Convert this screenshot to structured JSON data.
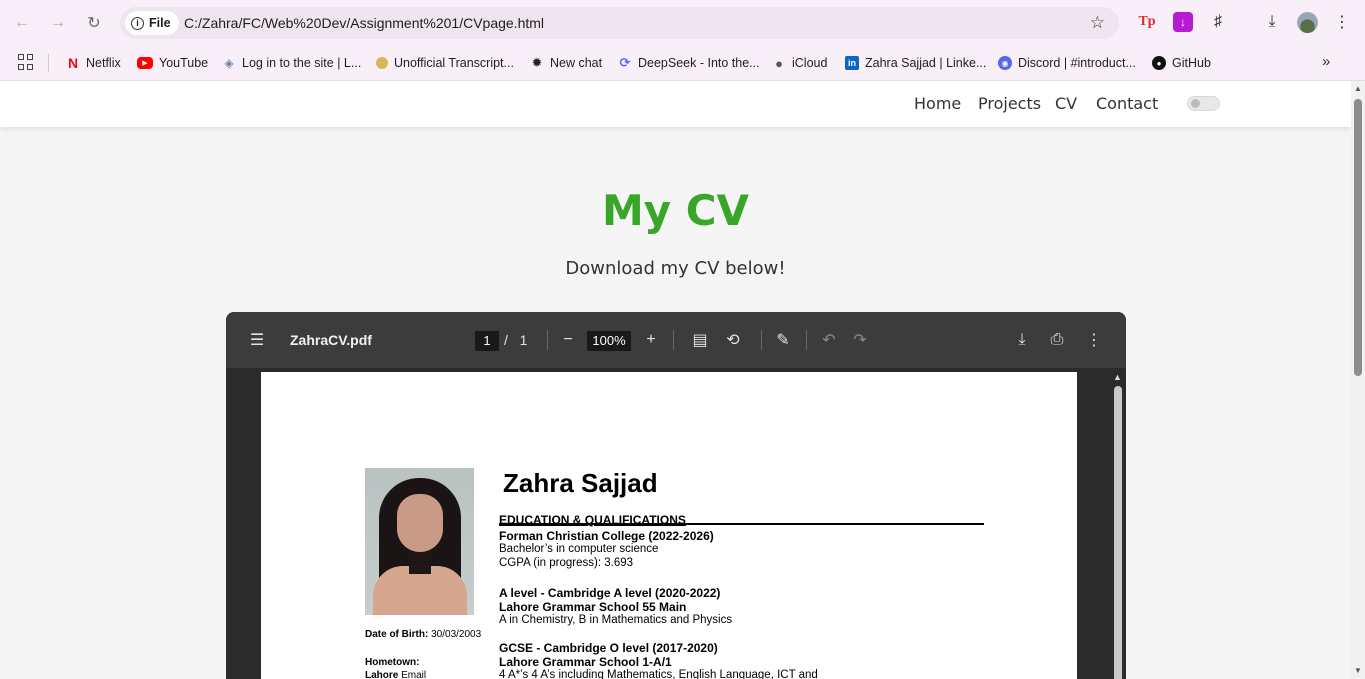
{
  "browser": {
    "site_badge": "File",
    "url": "C:/Zahra/FC/Web%20Dev/Assignment%201/CVpage.html",
    "bookmarks": [
      {
        "label": "Netflix",
        "icon": "netflix-icon"
      },
      {
        "label": "YouTube",
        "icon": "youtube-icon"
      },
      {
        "label": "Log in to the site | L...",
        "icon": "moodle-icon"
      },
      {
        "label": "Unofficial Transcript...",
        "icon": "transcript-icon"
      },
      {
        "label": "New chat",
        "icon": "chatgpt-icon"
      },
      {
        "label": "DeepSeek - Into the...",
        "icon": "deepseek-icon"
      },
      {
        "label": "iCloud",
        "icon": "apple-icon"
      },
      {
        "label": "Zahra Sajjad | Linke...",
        "icon": "linkedin-icon"
      },
      {
        "label": "Discord | #introduct...",
        "icon": "discord-icon"
      },
      {
        "label": "GitHub",
        "icon": "github-icon"
      }
    ]
  },
  "site": {
    "nav": [
      "Home",
      "Projects",
      "CV",
      "Contact"
    ],
    "title": "My CV",
    "subtitle": "Download my CV below!"
  },
  "pdf_viewer": {
    "filename": "ZahraCV.pdf",
    "current_page": "1",
    "page_sep": "/",
    "total_pages": "1",
    "zoom": "100%"
  },
  "cv": {
    "name": "Zahra Sajjad",
    "section_heading": "EDUCATION & QUALIFICATIONS",
    "entries": [
      {
        "title": "Forman Christian College (2022-2026)",
        "lines": [
          "Bachelor’s in computer science",
          "CGPA (in progress): 3.693"
        ]
      },
      {
        "title": "A level - Cambridge A level (2020-2022)",
        "title2": "Lahore Grammar School 55 Main",
        "lines": [
          "A in Chemistry, B in Mathematics and Physics"
        ]
      },
      {
        "title": "GCSE - Cambridge O level (2017-2020)",
        "title2": "Lahore Grammar School 1-A/1",
        "lines": [
          "4 A*’s 4 A’s including Mathematics, English Language, ICT and"
        ]
      }
    ],
    "dob_label": "Date of Birth:",
    "dob_value": "30/03/2003",
    "hometown_label": "Hometown:",
    "hometown_value": "Lahore",
    "email_label": "Email"
  }
}
